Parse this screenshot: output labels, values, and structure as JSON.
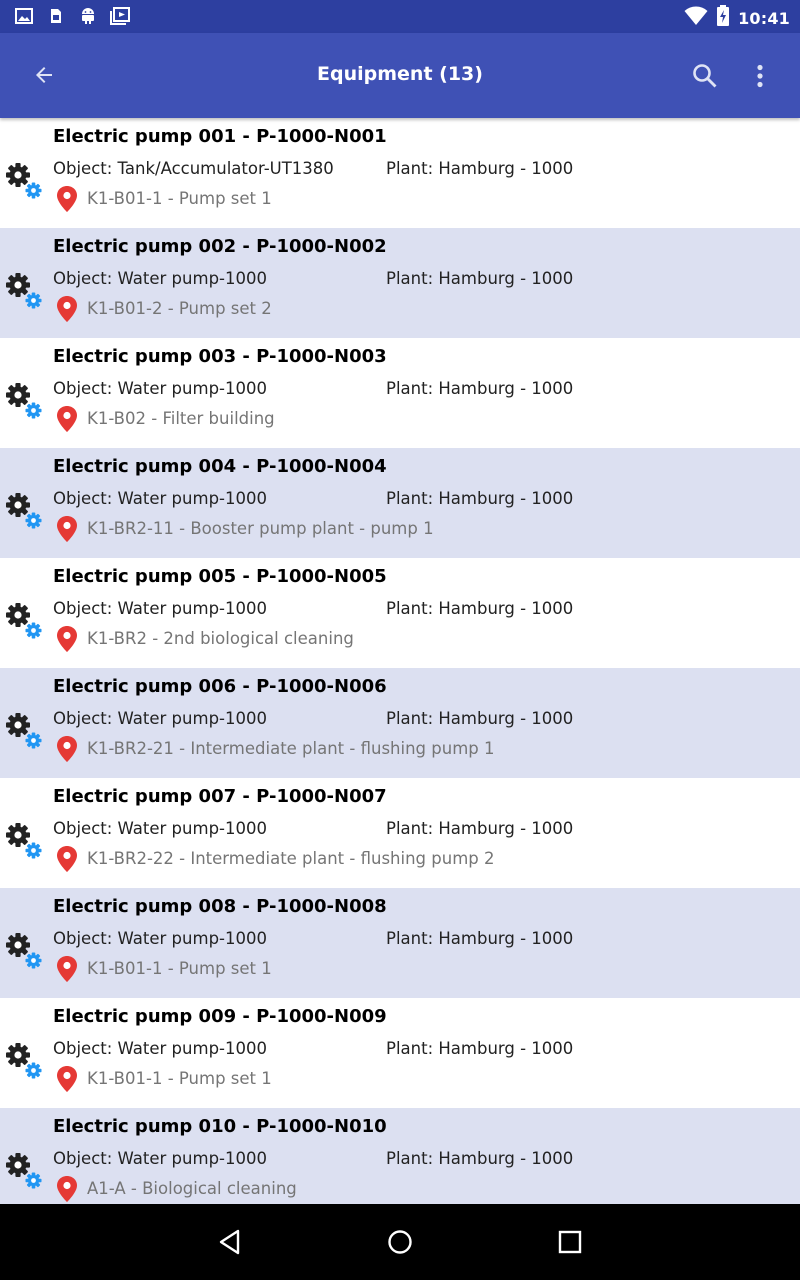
{
  "status_bar": {
    "time": "10:41",
    "left_icons": [
      "image-icon",
      "sim-card-icon",
      "android-icon",
      "media-library-icon"
    ],
    "right_icons": [
      "wifi-icon",
      "battery-charging-icon"
    ]
  },
  "app_bar": {
    "title": "Equipment (13)",
    "back_icon": "arrow-back-icon",
    "search_icon": "search-icon",
    "more_icon": "more-vert-icon"
  },
  "colors": {
    "status_bar": "#2d3fa0",
    "app_bar": "#3f51b5",
    "row_alt": "#dce0f1",
    "pin": "#e53935",
    "gear_dark": "#222222",
    "gear_blue": "#2196f3"
  },
  "equipment": [
    {
      "name": "Electric pump 001 - P-1000-N001",
      "object": "Object: Tank/Accumulator-UT1380",
      "plant": "Plant: Hamburg - 1000",
      "location": "K1-B01-1 - Pump set 1"
    },
    {
      "name": "Electric pump 002 - P-1000-N002",
      "object": "Object: Water pump-1000",
      "plant": "Plant: Hamburg - 1000",
      "location": "K1-B01-2 - Pump set 2"
    },
    {
      "name": "Electric pump 003 - P-1000-N003",
      "object": "Object: Water pump-1000",
      "plant": "Plant: Hamburg - 1000",
      "location": "K1-B02 - Filter building"
    },
    {
      "name": "Electric pump 004 - P-1000-N004",
      "object": "Object: Water pump-1000",
      "plant": "Plant: Hamburg - 1000",
      "location": "K1-BR2-11 - Booster pump plant - pump 1"
    },
    {
      "name": "Electric pump 005 - P-1000-N005",
      "object": "Object: Water pump-1000",
      "plant": "Plant: Hamburg - 1000",
      "location": "K1-BR2 - 2nd biological cleaning"
    },
    {
      "name": "Electric pump 006 - P-1000-N006",
      "object": "Object: Water pump-1000",
      "plant": "Plant: Hamburg - 1000",
      "location": "K1-BR2-21 - Intermediate plant - flushing pump 1"
    },
    {
      "name": "Electric pump 007 - P-1000-N007",
      "object": "Object: Water pump-1000",
      "plant": "Plant: Hamburg - 1000",
      "location": "K1-BR2-22 - Intermediate plant - flushing pump 2"
    },
    {
      "name": "Electric pump 008 - P-1000-N008",
      "object": "Object: Water pump-1000",
      "plant": "Plant: Hamburg - 1000",
      "location": "K1-B01-1 - Pump set 1"
    },
    {
      "name": "Electric pump 009 - P-1000-N009",
      "object": "Object: Water pump-1000",
      "plant": "Plant: Hamburg - 1000",
      "location": "K1-B01-1 - Pump set 1"
    },
    {
      "name": "Electric pump 010 - P-1000-N010",
      "object": "Object: Water pump-1000",
      "plant": "Plant: Hamburg - 1000",
      "location": "A1-A - Biological cleaning"
    }
  ],
  "nav_bar": {
    "back_icon": "nav-back-icon",
    "home_icon": "nav-home-icon",
    "recents_icon": "nav-recents-icon"
  }
}
